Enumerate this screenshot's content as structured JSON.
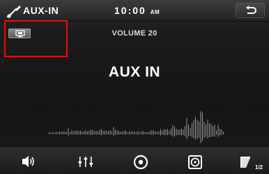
{
  "header": {
    "title": "AUX-IN",
    "clock_time": "10:00",
    "clock_ampm": "AM"
  },
  "volume": {
    "label": "VOLUME 20"
  },
  "main": {
    "title": "AUX IN"
  },
  "bottom_bar": {
    "page_indicator": "1/2"
  },
  "colors": {
    "highlight": "#e01010",
    "text": "#ffffff",
    "background": "#151515"
  },
  "icons": {
    "source": "guitar-icon",
    "back": "back-arrow-icon",
    "display": "display-icon",
    "volume": "speaker-icon",
    "equalizer": "equalizer-icon",
    "disc": "disc-icon",
    "media": "media-icon",
    "menu": "menu-page-icon"
  }
}
